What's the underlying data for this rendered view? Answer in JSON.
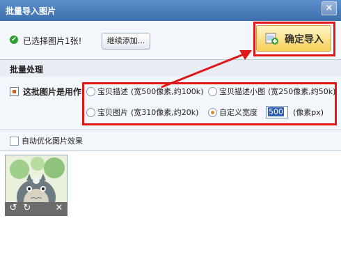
{
  "window": {
    "title": "批量导入图片",
    "close_glyph": "×"
  },
  "selection": {
    "status_text": "已选择图片1张!",
    "add_more_label": "继续添加..."
  },
  "confirm": {
    "label": "确定导入"
  },
  "batch": {
    "section_title": "批量处理",
    "usage_label": "这批图片是用作",
    "options": [
      {
        "label": "宝贝描述",
        "hint": "(宽500像素,约100k)",
        "selected": false
      },
      {
        "label": "宝贝描述小图",
        "hint": "(宽250像素,约50k)",
        "selected": false
      },
      {
        "label": "宝贝图片",
        "hint": "(宽310像素,约20k)",
        "selected": false
      },
      {
        "label": "自定义宽度",
        "hint": "",
        "selected": true
      }
    ],
    "custom_width_value": "500",
    "custom_width_unit": "(像素px)"
  },
  "optimize": {
    "label": "自动优化图片效果",
    "checked": false
  },
  "thumbnail": {
    "icons": [
      "rotate-left-icon",
      "rotate-right-icon",
      "delete-icon"
    ]
  },
  "colors": {
    "title_bar": "#4a7fbf",
    "highlight_red": "#e11616",
    "confirm_yellow": "#f6cf57"
  }
}
